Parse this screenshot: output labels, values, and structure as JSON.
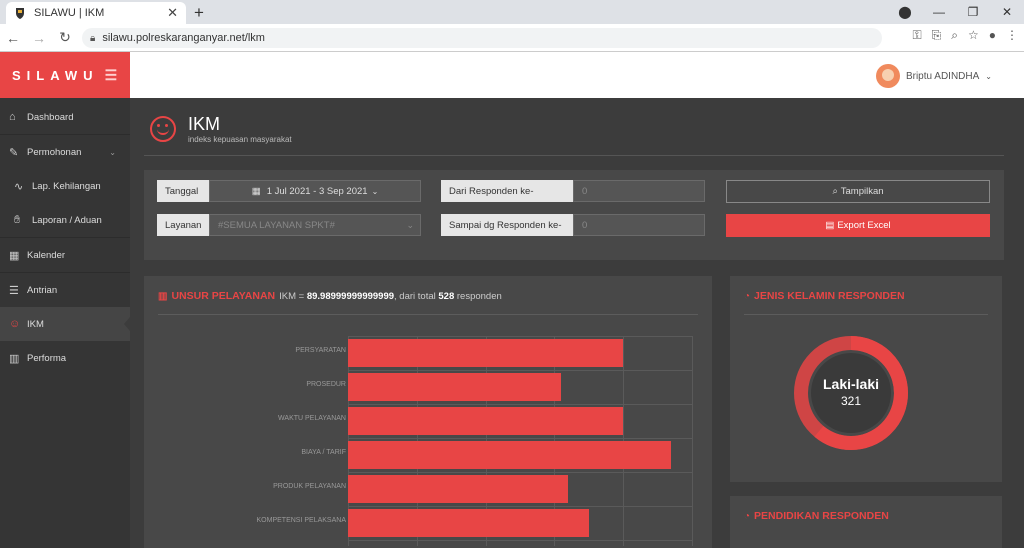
{
  "browser": {
    "tab_title": "SILAWU | IKM",
    "url": "silawu.polreskaranganyar.net/lkm"
  },
  "app": {
    "brand": "SILAWU"
  },
  "user": {
    "name": "Briptu ADINDHA"
  },
  "sidebar": {
    "items": [
      {
        "label": "Dashboard",
        "icon": "home-icon"
      },
      {
        "label": "Permohonan",
        "icon": "edit-icon"
      },
      {
        "label": "Lap. Kehilangan",
        "icon": "fingerprint-icon"
      },
      {
        "label": "Laporan / Aduan",
        "icon": "hand-icon"
      },
      {
        "label": "Kalender",
        "icon": "calendar-icon"
      },
      {
        "label": "Antrian",
        "icon": "list-icon"
      },
      {
        "label": "IKM",
        "icon": "smile-icon"
      },
      {
        "label": "Performa",
        "icon": "bar-chart-icon"
      }
    ]
  },
  "page": {
    "title": "IKM",
    "subtitle": "indeks kepuasan masyarakat"
  },
  "filter": {
    "tanggal_label": "Tanggal",
    "tanggal_value": "1 Jul 2021 - 3 Sep 2021",
    "layanan_label": "Layanan",
    "layanan_value": "#SEMUA LAYANAN SPKT#",
    "dari_label": "Dari Responden ke-",
    "dari_value": "0",
    "sampai_label": "Sampai dg Responden ke-",
    "sampai_value": "0",
    "tampilkan_label": "Tampilkan",
    "export_label": "Export Excel"
  },
  "unsur": {
    "title": "UNSUR PELAYANAN",
    "ikm_prefix": "IKM = ",
    "ikm_value": "89.98999999999999",
    "total_prefix": ", dari total ",
    "total": "528",
    "total_suffix": " responden"
  },
  "chart_data": {
    "type": "bar",
    "orientation": "horizontal",
    "categories": [
      "PERSYARATAN",
      "PROSEDUR",
      "WAKTU PELAYANAN",
      "BIAYA / TARIF",
      "PRODUK PELAYANAN",
      "KOMPETENSI PELAKSANA"
    ],
    "values": [
      80,
      62,
      80,
      94,
      64,
      70
    ],
    "xlim": [
      0,
      100
    ]
  },
  "jenis_kelamin": {
    "title": "JENIS KELAMIN RESPONDEN",
    "label": "Laki-laki",
    "value": "321",
    "share": 0.61,
    "accent": "#e84545"
  },
  "pendidikan": {
    "title": "PENDIDIKAN RESPONDEN"
  }
}
